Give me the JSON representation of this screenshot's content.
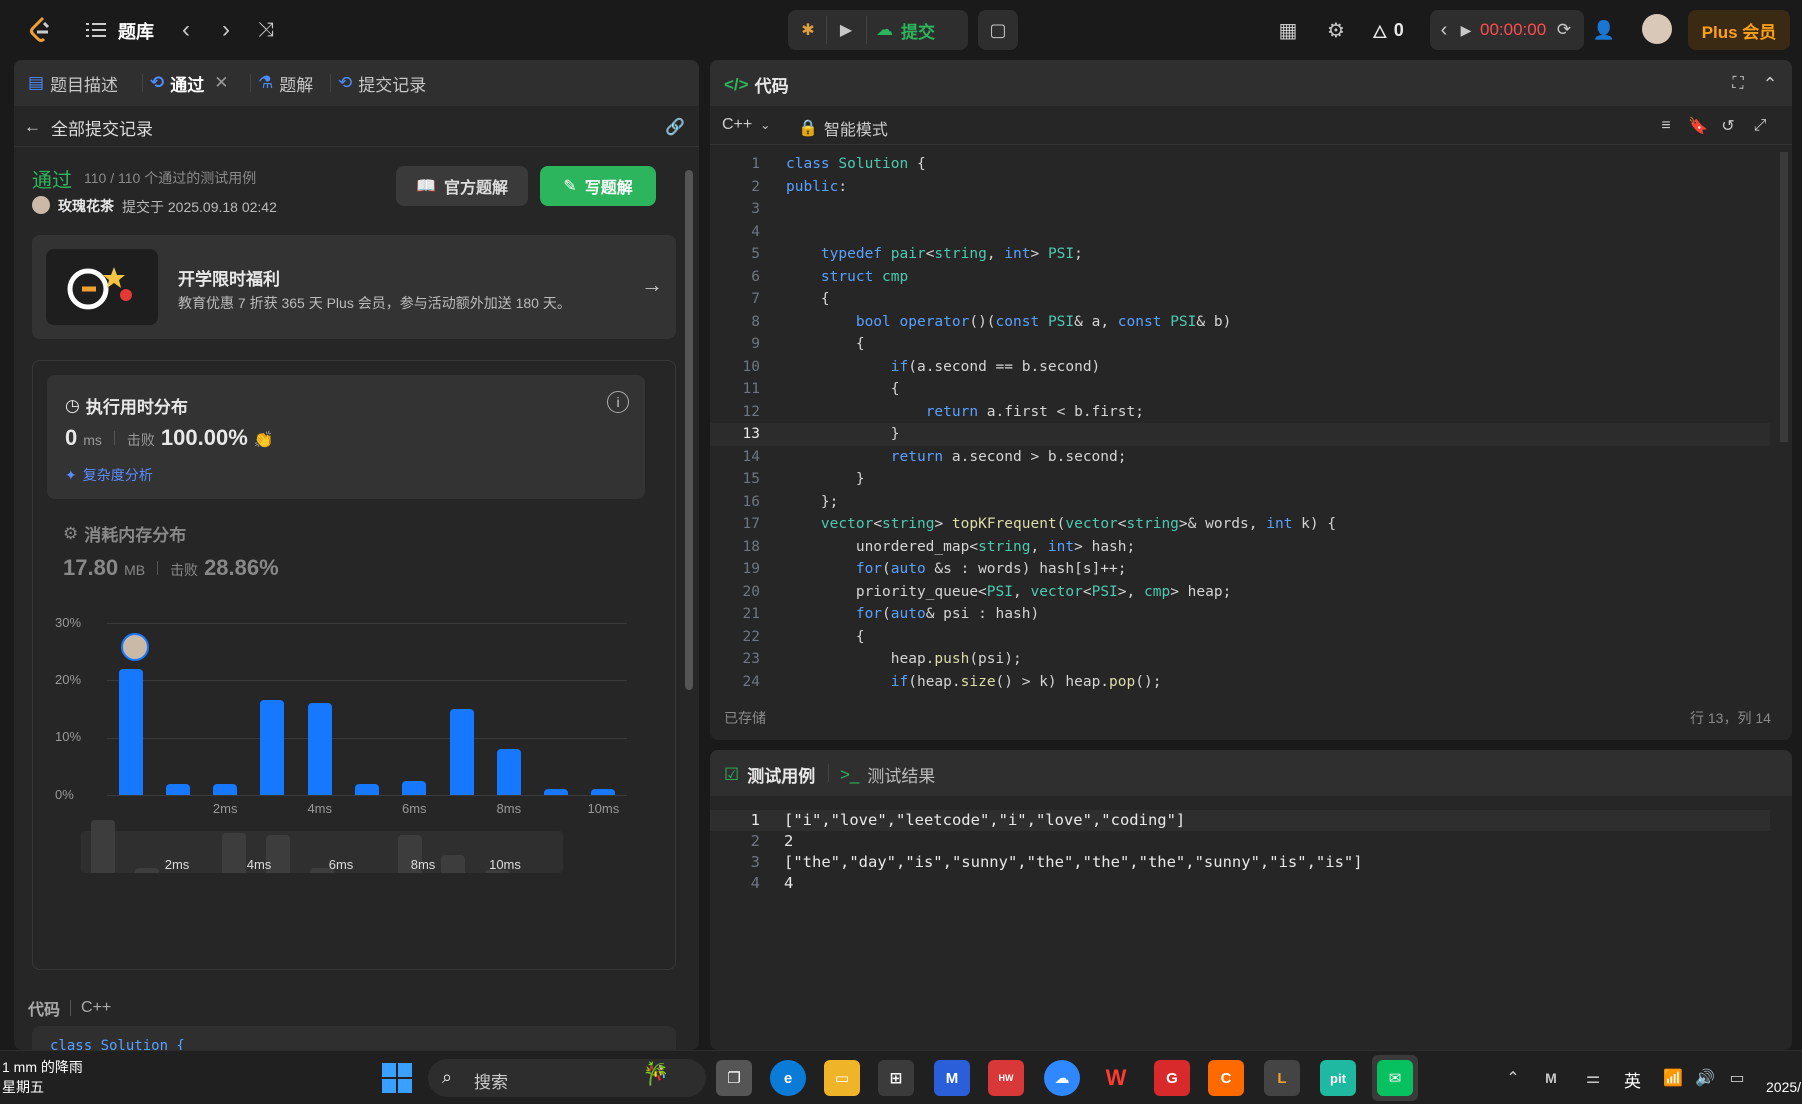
{
  "topbar": {
    "problem_list": "题库",
    "submit": "提交",
    "flame_count": "0",
    "timer": "00:00:00",
    "plus": "Plus 会员"
  },
  "left": {
    "tabs": [
      {
        "label": "题目描述"
      },
      {
        "label": "通过"
      },
      {
        "label": "题解"
      },
      {
        "label": "提交记录"
      }
    ],
    "back_label": "全部提交记录",
    "status": "通过",
    "status_detail": "110 / 110 个通过的测试用例",
    "user": "玫瑰花茶",
    "submit_time": "提交于 2025.09.18 02:42",
    "official_solution": "官方题解",
    "write_solution": "写题解",
    "promo_title": "开学限时福利",
    "promo_desc": "教育优惠 7 折获 365 天 Plus 会员，参与活动额外加送 180 天。",
    "runtime_title": "执行用时分布",
    "runtime_value": "0",
    "runtime_unit": "ms",
    "beats_label": "击败",
    "runtime_beats": "100.00%",
    "complexity": "复杂度分析",
    "memory_title": "消耗内存分布",
    "memory_value": "17.80",
    "memory_unit": "MB",
    "memory_beats": "28.86%",
    "code_label": "代码",
    "code_lang": "C++",
    "code_preview": "class Solution {"
  },
  "chart_data": {
    "type": "bar",
    "title": "执行用时分布",
    "ylabel": "",
    "xlabel": "",
    "yticks": [
      "30%",
      "20%",
      "10%",
      "0%"
    ],
    "xticks": [
      "2ms",
      "4ms",
      "6ms",
      "8ms",
      "10ms"
    ],
    "ylim": [
      0,
      30
    ],
    "values": [
      22,
      2,
      2,
      16.5,
      16,
      2,
      2.5,
      15,
      8,
      1,
      1
    ],
    "mini_values": [
      21,
      2,
      0,
      16,
      15,
      2,
      0,
      15,
      7,
      1,
      0
    ],
    "mini_xticks": [
      "2ms",
      "4ms",
      "6ms",
      "8ms",
      "10ms"
    ]
  },
  "editor": {
    "title": "代码",
    "lang": "C++",
    "mode": "智能模式",
    "saved": "已存储",
    "position": "行 13，列 14",
    "lines": [
      "class Solution {",
      "public:",
      "",
      "",
      "    typedef pair<string, int> PSI;",
      "    struct cmp",
      "    {",
      "        bool operator()(const PSI& a, const PSI& b)",
      "        {",
      "            if(a.second == b.second)",
      "            {",
      "                return a.first < b.first;",
      "            }",
      "            return a.second > b.second;",
      "        }",
      "    };",
      "    vector<string> topKFrequent(vector<string>& words, int k) {",
      "        unordered_map<string, int> hash;",
      "        for(auto &s : words) hash[s]++;",
      "        priority_queue<PSI, vector<PSI>, cmp> heap;",
      "        for(auto& psi : hash)",
      "        {",
      "            heap.push(psi);",
      "            if(heap.size() > k) heap.pop();"
    ]
  },
  "testcase": {
    "tab1": "测试用例",
    "tab2": "测试结果",
    "lines": [
      "[\"i\",\"love\",\"leetcode\",\"i\",\"love\",\"coding\"]",
      "2",
      "[\"the\",\"day\",\"is\",\"sunny\",\"the\",\"the\",\"the\",\"sunny\",\"is\",\"is\"]",
      "4"
    ]
  },
  "taskbar": {
    "weather": "1 mm 的降雨",
    "weekday": "星期五",
    "search": "搜索",
    "ime": "英",
    "clock": "2025/"
  }
}
